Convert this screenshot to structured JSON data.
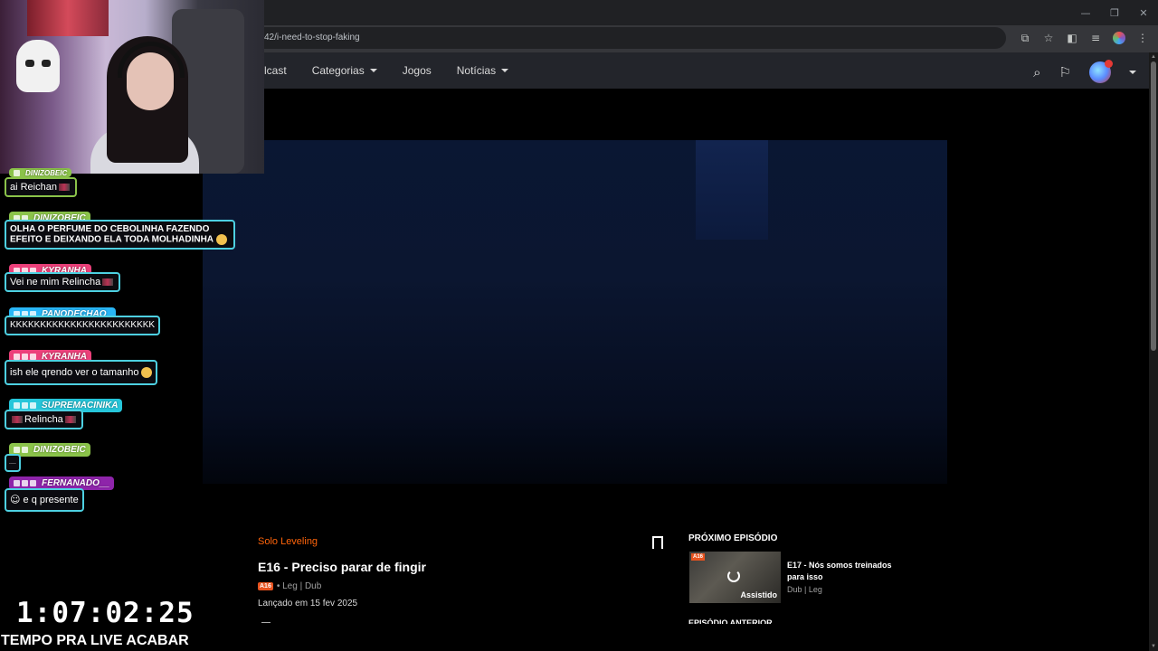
{
  "browser": {
    "url": "42/i-need-to-stop-faking",
    "window_controls": [
      "—",
      "❐",
      "✕"
    ],
    "toolbar_icons": [
      "install-app-icon",
      "star-icon",
      "extensions-icon",
      "media-icon",
      "profile-icon",
      "menu-icon"
    ]
  },
  "site_nav": {
    "items": [
      {
        "label": "lcast",
        "dropdown": false
      },
      {
        "label": "Categorias",
        "dropdown": true
      },
      {
        "label": "Jogos",
        "dropdown": false
      },
      {
        "label": "Notícias",
        "dropdown": true
      }
    ]
  },
  "episode": {
    "series": "Solo Leveling",
    "title": "E16 - Preciso parar de fingir",
    "rating": "A16",
    "audio": "• Leg | Dub",
    "release": "Lançado em 15 fev 2025"
  },
  "next_episode": {
    "label": "PRÓXIMO EPISÓDIO",
    "rating": "A16",
    "watched": "Assistido",
    "title": "E17 - Nós somos treinados para isso",
    "meta": "Dub | Leg"
  },
  "previous_label": "EPISÓDIO ANTERIOR",
  "chat": {
    "messages": [
      {
        "user": "DINIZOBEIC",
        "text": "ai Reichan",
        "color": "#8bc34a",
        "partial": true
      },
      {
        "user": "DINIZOBEIC",
        "text": "OLHA O PERFUME DO CEBOLINHA FAZENDO EFEITO E DEIXANDO ELA TODA MOLHADINHA",
        "color": "#8bc34a"
      },
      {
        "user": "KYRANHA",
        "text": "Vei ne mim Relincha",
        "color": "#ec407a"
      },
      {
        "user": "PANODECHAO_",
        "text": "KKKKKKKKKKKKKKKKKKKKKKKK",
        "color": "#29b6f6"
      },
      {
        "user": "KYRANHA",
        "text": "ish ele qrendo ver o tamanho",
        "color": "#ec407a"
      },
      {
        "user": "SUPREMACINIKA",
        "text": "Relincha",
        "color": "#26c6da"
      },
      {
        "user": "DINIZOBEIC",
        "text": "....",
        "color": "#8bc34a"
      },
      {
        "user": "FERNANADO__",
        "text": "e q presente",
        "color": "#8e24aa"
      }
    ]
  },
  "overlay": {
    "timer": "1:07:02:25",
    "timer_label": "TEMPO PRA LIVE ACABAR"
  }
}
